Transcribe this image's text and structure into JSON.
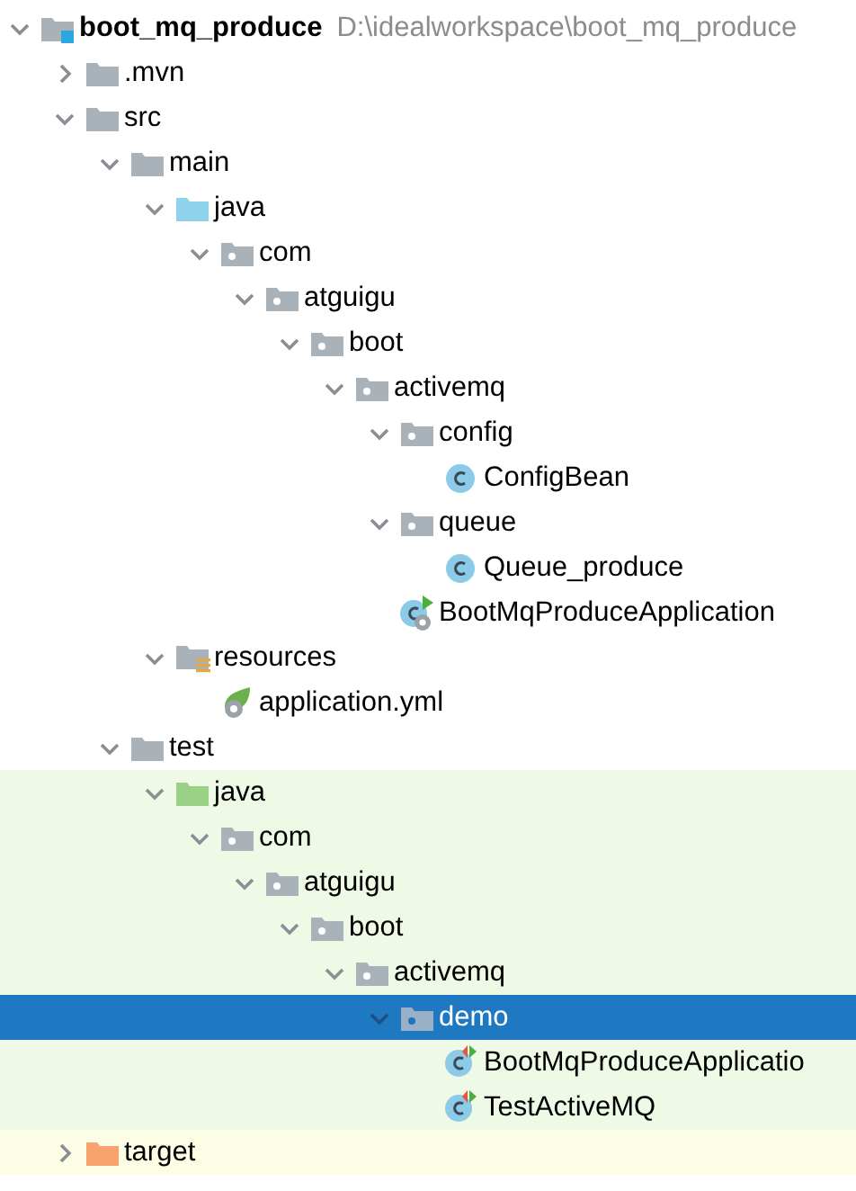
{
  "project_tree": {
    "nodes": [
      {
        "label": "boot_mq_produce",
        "path": "D:\\idealworkspace\\boot_mq_produce",
        "kind": "module",
        "expanded": true,
        "selected": false,
        "children": [
          {
            "label": ".mvn",
            "kind": "folder",
            "expanded": false,
            "selected": false
          },
          {
            "label": "src",
            "kind": "folder",
            "expanded": true,
            "selected": false,
            "children": [
              {
                "label": "main",
                "kind": "folder",
                "expanded": true,
                "selected": false,
                "children": [
                  {
                    "label": "java",
                    "kind": "source_root",
                    "expanded": true,
                    "selected": false,
                    "children": [
                      {
                        "label": "com",
                        "kind": "package",
                        "expanded": true,
                        "selected": false,
                        "children": [
                          {
                            "label": "atguigu",
                            "kind": "package",
                            "expanded": true,
                            "selected": false,
                            "children": [
                              {
                                "label": "boot",
                                "kind": "package",
                                "expanded": true,
                                "selected": false,
                                "children": [
                                  {
                                    "label": "activemq",
                                    "kind": "package",
                                    "expanded": true,
                                    "selected": false,
                                    "children": [
                                      {
                                        "label": "config",
                                        "kind": "package",
                                        "expanded": true,
                                        "selected": false,
                                        "children": [
                                          {
                                            "label": "ConfigBean",
                                            "kind": "class",
                                            "selected": false
                                          }
                                        ]
                                      },
                                      {
                                        "label": "queue",
                                        "kind": "package",
                                        "expanded": true,
                                        "selected": false,
                                        "children": [
                                          {
                                            "label": "Queue_produce",
                                            "kind": "class",
                                            "selected": false
                                          }
                                        ]
                                      },
                                      {
                                        "label": "BootMqProduceApplication",
                                        "kind": "spring_app_class",
                                        "selected": false
                                      }
                                    ]
                                  }
                                ]
                              }
                            ]
                          }
                        ]
                      }
                    ]
                  },
                  {
                    "label": "resources",
                    "kind": "resources_root",
                    "expanded": true,
                    "selected": false,
                    "children": [
                      {
                        "label": "application.yml",
                        "kind": "spring_config",
                        "selected": false
                      }
                    ]
                  }
                ]
              },
              {
                "label": "test",
                "kind": "folder",
                "expanded": true,
                "selected": false,
                "children": [
                  {
                    "label": "java",
                    "kind": "test_root",
                    "expanded": true,
                    "selected": false,
                    "children": [
                      {
                        "label": "com",
                        "kind": "package",
                        "expanded": true,
                        "selected": false,
                        "children": [
                          {
                            "label": "atguigu",
                            "kind": "package",
                            "expanded": true,
                            "selected": false,
                            "children": [
                              {
                                "label": "boot",
                                "kind": "package",
                                "expanded": true,
                                "selected": false,
                                "children": [
                                  {
                                    "label": "activemq",
                                    "kind": "package",
                                    "expanded": true,
                                    "selected": false,
                                    "children": [
                                      {
                                        "label": "demo",
                                        "kind": "package",
                                        "expanded": true,
                                        "selected": true,
                                        "children": [
                                          {
                                            "label": "BootMqProduceApplicatio",
                                            "kind": "test_class",
                                            "selected": false
                                          },
                                          {
                                            "label": "TestActiveMQ",
                                            "kind": "test_class",
                                            "selected": false
                                          }
                                        ]
                                      }
                                    ]
                                  }
                                ]
                              }
                            ]
                          }
                        ]
                      }
                    ]
                  }
                ]
              }
            ]
          },
          {
            "label": "target",
            "kind": "excluded_folder",
            "expanded": false,
            "selected": false
          }
        ]
      }
    ]
  }
}
